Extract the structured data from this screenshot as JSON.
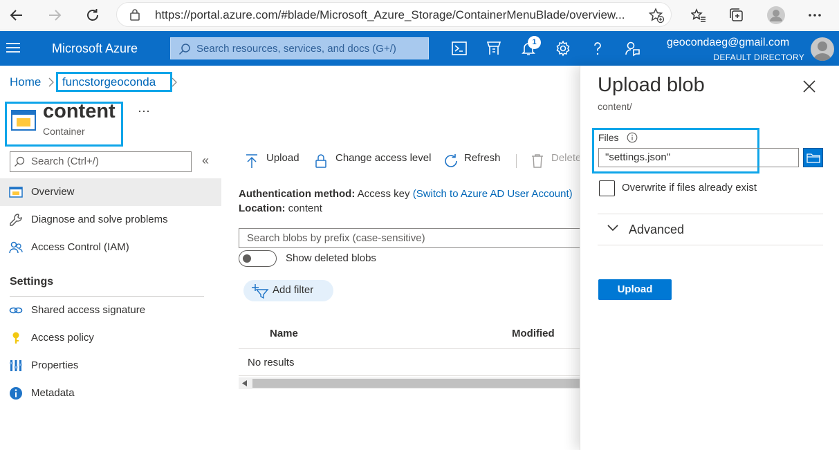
{
  "browser": {
    "url": "https://portal.azure.com/#blade/Microsoft_Azure_Storage/ContainerMenuBlade/overview..."
  },
  "azure": {
    "brand": "Microsoft Azure",
    "search_placeholder": "Search resources, services, and docs (G+/)",
    "notification_count": "1",
    "user_email": "geocondaeg@gmail.com",
    "user_directory": "DEFAULT DIRECTORY"
  },
  "breadcrumb": {
    "home": "Home",
    "sep": ">",
    "account": "funcstorgeoconda",
    "trail_sep": ">"
  },
  "resource": {
    "title": "content",
    "type": "Container",
    "more": "···"
  },
  "leftnav": {
    "search_placeholder": "Search (Ctrl+/)",
    "collapse": "«",
    "items": [
      {
        "label": "Overview",
        "icon": "container-icon"
      },
      {
        "label": "Diagnose and solve problems",
        "icon": "wrench-icon"
      },
      {
        "label": "Access Control (IAM)",
        "icon": "people-icon"
      }
    ],
    "settings_header": "Settings",
    "settings_items": [
      {
        "label": "Shared access signature",
        "icon": "link-icon"
      },
      {
        "label": "Access policy",
        "icon": "key-icon"
      },
      {
        "label": "Properties",
        "icon": "properties-icon"
      },
      {
        "label": "Metadata",
        "icon": "info-icon"
      }
    ]
  },
  "toolbar": {
    "upload": "Upload",
    "change_access": "Change access level",
    "refresh": "Refresh",
    "delete": "Delete"
  },
  "overview": {
    "auth_label": "Authentication method:",
    "auth_value": "Access key",
    "auth_link": "(Switch to Azure AD User Account)",
    "location_label": "Location:",
    "location_value": "content",
    "blob_search_placeholder": "Search blobs by prefix (case-sensitive)",
    "show_deleted": "Show deleted blobs",
    "add_filter": "Add filter",
    "col_name": "Name",
    "col_modified": "Modified",
    "no_results": "No results"
  },
  "panel": {
    "title": "Upload blob",
    "subtitle": "content/",
    "files_label": "Files",
    "files_value": "\"settings.json\"",
    "overwrite_label": "Overwrite if files already exist",
    "advanced_label": "Advanced",
    "upload_button": "Upload"
  },
  "colors": {
    "azure_blue": "#0b6ec8",
    "link_blue": "#0067b8",
    "highlight": "#0ea5e9",
    "primary_button": "#0078d4"
  }
}
